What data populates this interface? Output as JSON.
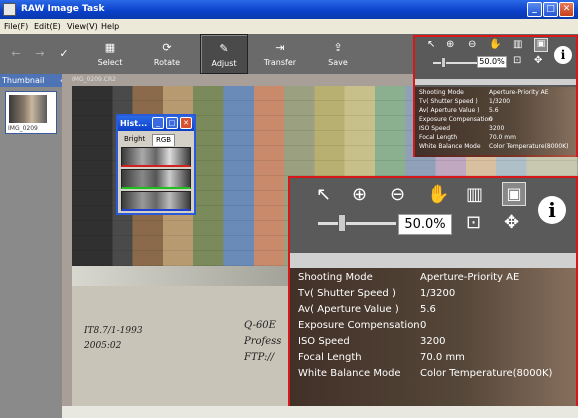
{
  "window": {
    "title": "RAW Image Task",
    "min": "_",
    "max": "□",
    "close": "✕"
  },
  "menu": [
    "File(F)",
    "Edit(E)",
    "View(V)",
    "Help"
  ],
  "toolbar": {
    "back": "←",
    "forward": "→",
    "check": "✓",
    "items": [
      {
        "label": "Select",
        "icon": "▦"
      },
      {
        "label": "Rotate",
        "icon": "⟳"
      },
      {
        "label": "Adjust",
        "icon": "✎"
      },
      {
        "label": "Transfer",
        "icon": "⇥"
      },
      {
        "label": "Save",
        "icon": "⇪"
      }
    ]
  },
  "thumbnail": {
    "header": "Thumbnail",
    "collapse": "«",
    "caption": "IMG_0209"
  },
  "image": {
    "filename": "IMG_0209.CR2"
  },
  "histogram": {
    "title": "Hist...",
    "tabs": [
      "Bright",
      "RGB"
    ]
  },
  "info": {
    "zoom": "50.0%",
    "info_symbol": "i",
    "rows": [
      [
        "Shooting Mode",
        "Aperture-Priority AE"
      ],
      [
        "Tv( Shutter Speed )",
        "1/3200"
      ],
      [
        "Av( Aperture Value )",
        "5.6"
      ],
      [
        "Exposure Compensation",
        "0"
      ],
      [
        "ISO Speed",
        "3200"
      ],
      [
        "Focal Length",
        "70.0 mm"
      ],
      [
        "White Balance Mode",
        "Color Temperature(8000K)"
      ]
    ]
  },
  "chart_text": [
    "IT8.7/1-1993",
    "2005:02",
    "Q-60E",
    "Profess",
    "FTP://"
  ]
}
